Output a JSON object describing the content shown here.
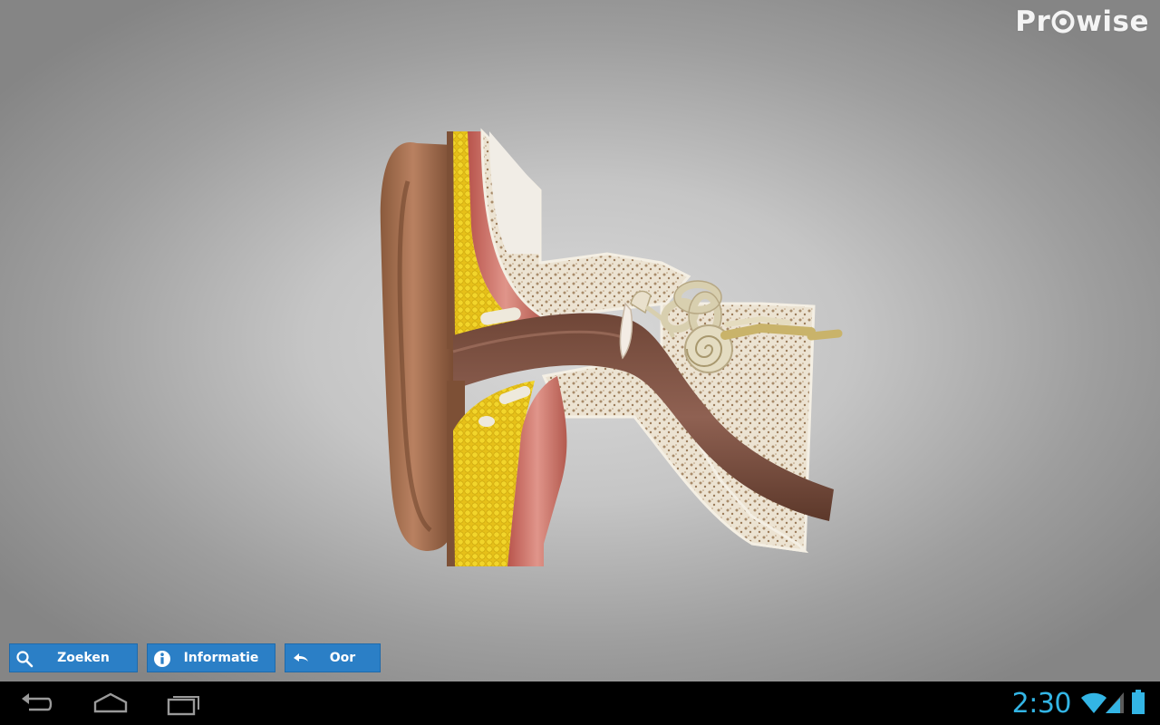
{
  "app": {
    "brand": "Pro wise",
    "brand_left": "Pr",
    "brand_right": "wise",
    "model_subject": "Oor"
  },
  "toolbar": {
    "search_label": "Zoeken",
    "info_label": "Informatie",
    "back_label": "Oor",
    "accent_color": "#2b7fc6"
  },
  "system_bar": {
    "time": "2:30",
    "clock_color": "#33b5e5",
    "icons": [
      "back-icon",
      "home-icon",
      "recent-apps-icon",
      "wifi-icon",
      "signal-icon",
      "battery-icon"
    ]
  }
}
